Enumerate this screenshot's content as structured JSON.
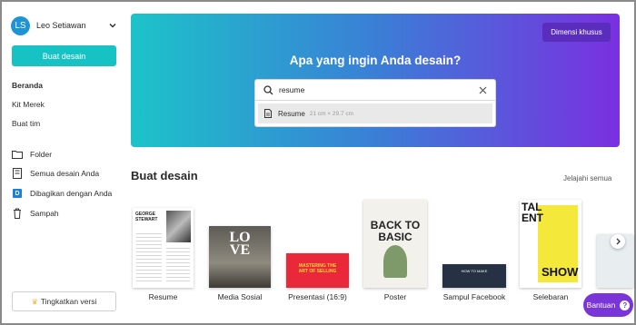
{
  "profile": {
    "initials": "LS",
    "name": "Leo Setiawan"
  },
  "sidebar": {
    "create_label": "Buat desain",
    "nav": [
      "Beranda",
      "Kit Merek",
      "Buat tim"
    ],
    "folders": [
      {
        "label": "Folder",
        "icon": "folder-icon"
      },
      {
        "label": "Semua desain Anda",
        "icon": "designs-icon"
      },
      {
        "label": "Dibagikan dengan Anda",
        "icon": "shared-icon",
        "badge": "D"
      },
      {
        "label": "Sampah",
        "icon": "trash-icon"
      }
    ],
    "upgrade_label": "Tingkatkan versi"
  },
  "hero": {
    "custom_size_label": "Dimensi khusus",
    "title": "Apa yang ingin Anda desain?",
    "search_value": "resume",
    "suggestion": {
      "label": "Resume",
      "dimensions": "21 cm × 29.7 cm"
    }
  },
  "section": {
    "title": "Buat desain",
    "explore_label": "Jelajahi semua",
    "cards": [
      {
        "label": "Resume",
        "thumb_text": [
          "GEORGE",
          "STEWART"
        ]
      },
      {
        "label": "Media Sosial",
        "thumb_text": [
          "L",
          "O",
          "V",
          "E"
        ]
      },
      {
        "label": "Presentasi (16:9)",
        "thumb_text": [
          "MASTERING THE",
          "ART OF SELLING"
        ]
      },
      {
        "label": "Poster",
        "thumb_text": [
          "BACK TO",
          "BASIC"
        ]
      },
      {
        "label": "Sampul Facebook",
        "thumb_text": [
          "HOW TO MAKE"
        ]
      },
      {
        "label": "Selebaran",
        "thumb_text": [
          "TALENT",
          "SHOW"
        ]
      }
    ]
  },
  "help_label": "Bantuan",
  "colors": {
    "accent_teal": "#17c2c4",
    "purple": "#7a35d9",
    "gradient_start": "#1cc3c9",
    "gradient_end": "#7a2fe0"
  }
}
